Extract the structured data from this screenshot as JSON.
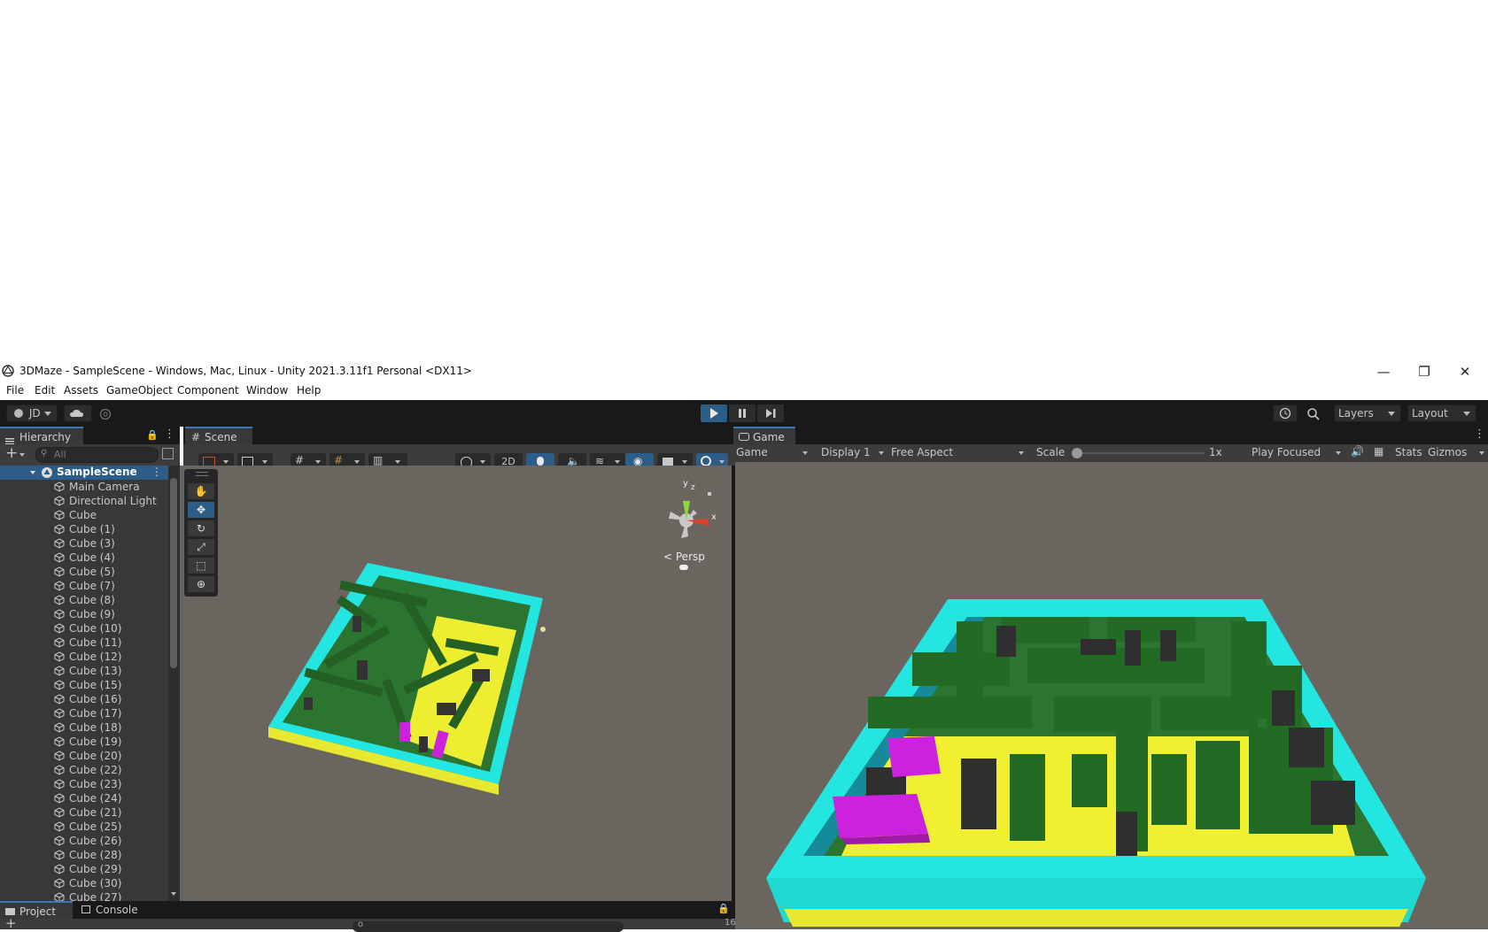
{
  "window": {
    "title": "3DMaze - SampleScene - Windows, Mac, Linux - Unity 2021.3.11f1 Personal <DX11>",
    "minimize_glyph": "—",
    "maximize_glyph": "❐",
    "close_glyph": "✕"
  },
  "menubar": [
    "File",
    "Edit",
    "Assets",
    "GameObject",
    "Component",
    "Window",
    "Help"
  ],
  "toolbar": {
    "account": "JD",
    "layers": "Layers",
    "layout": "Layout"
  },
  "hierarchy": {
    "tab": "Hierarchy",
    "search_placeholder": "All",
    "scene": "SampleScene",
    "items": [
      "Main Camera",
      "Directional Light",
      "Cube",
      "Cube (1)",
      "Cube (3)",
      "Cube (4)",
      "Cube (5)",
      "Cube (7)",
      "Cube (8)",
      "Cube (9)",
      "Cube (10)",
      "Cube (11)",
      "Cube (12)",
      "Cube (13)",
      "Cube (15)",
      "Cube (16)",
      "Cube (17)",
      "Cube (18)",
      "Cube (19)",
      "Cube (20)",
      "Cube (22)",
      "Cube (23)",
      "Cube (24)",
      "Cube (21)",
      "Cube (25)",
      "Cube (26)",
      "Cube (28)",
      "Cube (29)",
      "Cube (30)",
      "Cube (27)"
    ]
  },
  "scene_view": {
    "tab": "Scene",
    "mode_2d": "2D",
    "persp_label": "Persp",
    "gizmo_y": "y",
    "gizmo_z": "z",
    "gizmo_x": "x"
  },
  "game_view": {
    "tab": "Game",
    "mode": "Game",
    "display": "Display 1",
    "aspect": "Free Aspect",
    "scale_label": "Scale",
    "scale_value": "1x",
    "play_mode": "Play Focused",
    "stats": "Stats",
    "gizmos": "Gizmos"
  },
  "bottom": {
    "project_tab": "Project",
    "console_tab": "Console",
    "search_text": "o",
    "hidden_count": "16"
  },
  "colors": {
    "maze_wall": "#2a6a26",
    "maze_floor": "#f0f030",
    "maze_border": "#20e8e0",
    "magenta_block": "#cc22dd",
    "dark_block": "#3a3a3a",
    "scene_bg": "#6b6560",
    "play_accent": "#3a79bb"
  }
}
